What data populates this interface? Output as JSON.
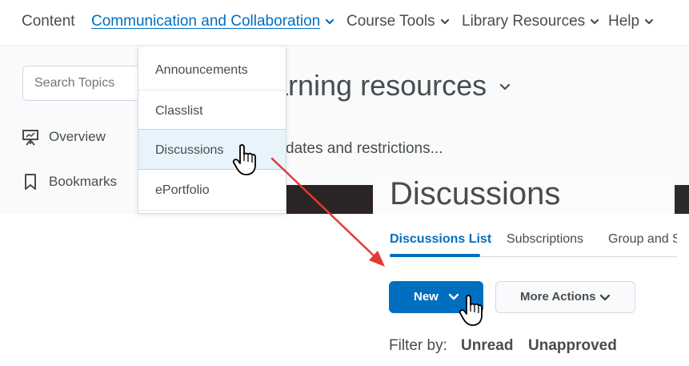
{
  "nav": {
    "content": "Content",
    "communication": "Communication and Collaboration",
    "course_tools": "Course Tools",
    "library": "Library Resources",
    "help": "Help"
  },
  "sidebar": {
    "search_placeholder": "Search Topics",
    "items": [
      {
        "label": "Overview",
        "icon": "presentation-icon"
      },
      {
        "label": "Bookmarks",
        "icon": "bookmark-icon"
      }
    ]
  },
  "background_page": {
    "title": "arning resources",
    "subtitle": "dates and restrictions..."
  },
  "dropdown": {
    "items": [
      "Announcements",
      "Classlist",
      "Discussions",
      "ePortfolio"
    ],
    "highlighted": "Discussions"
  },
  "discussions": {
    "title": "Discussions",
    "tabs": [
      "Discussions List",
      "Subscriptions",
      "Group and S"
    ],
    "active_tab": "Discussions List",
    "new_button": "New",
    "more_actions": "More Actions",
    "filter_label": "Filter by:",
    "filters": [
      "Unread",
      "Unapproved"
    ]
  },
  "colors": {
    "accent": "#006fbf",
    "arrow": "#e53935",
    "text": "#494c4e"
  }
}
